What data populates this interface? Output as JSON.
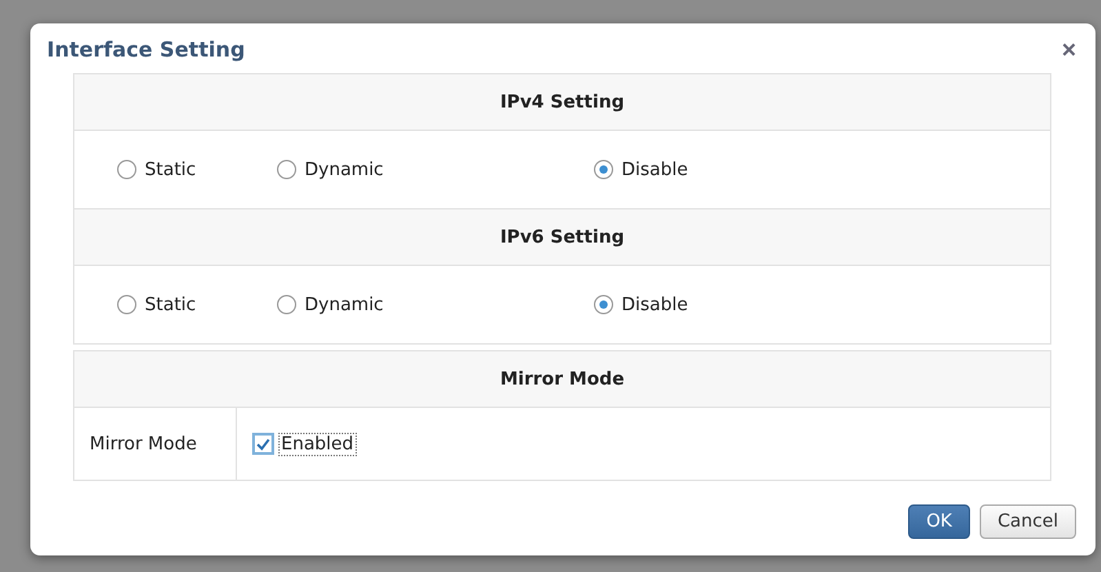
{
  "dialog": {
    "title": "Interface Setting",
    "close": "×"
  },
  "sections": [
    {
      "kind": "radio",
      "heading": "IPv4 Setting",
      "options": [
        {
          "label": "Static",
          "selected": false
        },
        {
          "label": "Dynamic",
          "selected": false
        },
        {
          "label": "Disable",
          "selected": true
        }
      ]
    },
    {
      "kind": "radio",
      "heading": "IPv6 Setting",
      "options": [
        {
          "label": "Static",
          "selected": false
        },
        {
          "label": "Dynamic",
          "selected": false
        },
        {
          "label": "Disable",
          "selected": true
        }
      ]
    },
    {
      "kind": "checkbox",
      "heading": "Mirror Mode",
      "label": "Mirror Mode",
      "option": {
        "label": "Enabled",
        "checked": true
      }
    }
  ],
  "buttons": [
    {
      "label": "OK",
      "kind": "primary"
    },
    {
      "label": "Cancel",
      "kind": "secondary"
    }
  ]
}
